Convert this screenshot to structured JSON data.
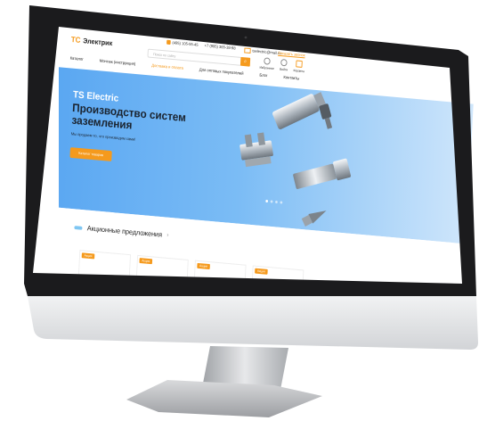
{
  "header": {
    "logo_mark": "TC",
    "logo_text": "Электрик",
    "phone_1": "(495) 105-55-45",
    "phone_2": "+7 (995) 365-38-98",
    "email": "tselectric@mail.ru",
    "callback": "Заказать звонок",
    "search_placeholder": "Поиск по сайту",
    "icons": [
      {
        "label": "Избранное",
        "icon": "heart-icon"
      },
      {
        "label": "Войти",
        "icon": "user-icon"
      },
      {
        "label": "Корзина",
        "icon": "cart-icon"
      }
    ],
    "nav": [
      "Каталог",
      "Монтаж (инструкция)",
      "Доставка и оплата",
      "Для оптовых покупателей",
      "Блог",
      "Контакты"
    ]
  },
  "hero": {
    "brand": "TS Electric",
    "headline": "Производство систем заземления",
    "subtitle": "Мы продаем то, что производим сами!",
    "cta": "Каталог товаров"
  },
  "promo": {
    "title": "Акционные предложения",
    "badges": [
      "Акция",
      "Акция",
      "Акция",
      "Акция"
    ]
  },
  "colors": {
    "accent": "#f59a1d",
    "hero_start": "#5aa7f2",
    "hero_end": "#cfe6fb",
    "bezel": "#1b1b1d",
    "chin": "#e6e7e9",
    "stand": "#c9cacc"
  }
}
